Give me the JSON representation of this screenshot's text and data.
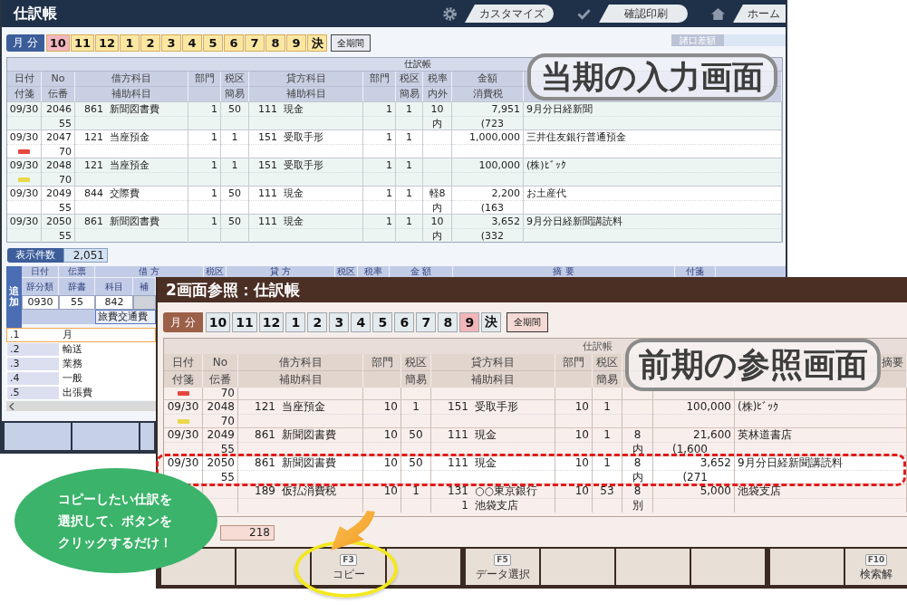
{
  "current_window": {
    "title": "仕訳帳",
    "toolbar": [
      {
        "kind": "gear",
        "label": "カスタマイズ"
      },
      {
        "kind": "check",
        "label": "確認印刷"
      },
      {
        "kind": "home",
        "label": "ホーム"
      }
    ],
    "period_bar": {
      "label": "月 分",
      "months": [
        {
          "label": "10",
          "selected": true
        },
        {
          "label": "11",
          "selected": false
        },
        {
          "label": "12",
          "selected": false
        },
        {
          "label": "1",
          "selected": false
        },
        {
          "label": "2",
          "selected": false
        },
        {
          "label": "3",
          "selected": false
        },
        {
          "label": "4",
          "selected": false
        },
        {
          "label": "5",
          "selected": false
        },
        {
          "label": "6",
          "selected": false
        },
        {
          "label": "7",
          "selected": false
        },
        {
          "label": "8",
          "selected": false
        },
        {
          "label": "9",
          "selected": false
        },
        {
          "label": "決",
          "selected": false
        }
      ],
      "all_label": "全期間"
    },
    "balance": {
      "label": "諸口差額"
    },
    "overlay_label": "当期の入力画面",
    "journal": {
      "title": "仕訳帳",
      "columns": [
        {
          "top": "日付",
          "bottom": "付箋"
        },
        {
          "top": "No",
          "bottom": "伝番"
        },
        {
          "top": "借方科目",
          "bottom": "補助科目"
        },
        {
          "top": "部門"
        },
        {
          "top": "税区",
          "bottom": "簡易"
        },
        {
          "top": "貸方科目",
          "bottom": "補助科目"
        },
        {
          "top": "部門"
        },
        {
          "top": "税区",
          "bottom": "簡易"
        },
        {
          "top": "税率",
          "bottom": "内外"
        },
        {
          "top": "金額",
          "bottom": "消費税"
        },
        {}
      ],
      "rows": [
        {
          "date": "09/30",
          "no": "2046",
          "slip": "55",
          "debit": {
            "code": "861",
            "name": "新聞図書費"
          },
          "debit_dept": "1",
          "tax": "50",
          "credit": {
            "code": "111",
            "name": "現金"
          },
          "credit_dept": "1",
          "credit_tax": "1",
          "rate": "10",
          "inout": "内",
          "amount": "7,951",
          "tax_amount": "(723",
          "memo": "9月分日経新聞"
        },
        {
          "date": "09/30",
          "note": {
            "color": "#e5463f"
          },
          "no": "2047",
          "slip": "70",
          "debit": {
            "code": "121",
            "name": "当座預金"
          },
          "debit_dept": "1",
          "tax": "1",
          "credit": {
            "code": "151",
            "name": "受取手形"
          },
          "credit_dept": "1",
          "credit_tax": "1",
          "amount": "1,000,000",
          "memo": "三井住友銀行普通預金"
        },
        {
          "date": "09/30",
          "note": {
            "color": "#e9d84a"
          },
          "no": "2048",
          "slip": "70",
          "debit": {
            "code": "121",
            "name": "当座預金"
          },
          "debit_dept": "1",
          "tax": "1",
          "credit": {
            "code": "151",
            "name": "受取手形"
          },
          "credit_dept": "1",
          "credit_tax": "1",
          "amount": "100,000",
          "memo": "(株)ﾋﾞｯｸ"
        },
        {
          "date": "09/30",
          "no": "2049",
          "slip": "55",
          "debit": {
            "code": "844",
            "name": "交際費"
          },
          "debit_dept": "1",
          "tax": "50",
          "credit": {
            "code": "111",
            "name": "現金"
          },
          "credit_dept": "1",
          "credit_tax": "1",
          "rate": "軽8",
          "inout": "内",
          "amount": "2,200",
          "tax_amount": "(163",
          "memo": "お土産代"
        },
        {
          "date": "09/30",
          "no": "2050",
          "slip": "55",
          "debit": {
            "code": "861",
            "name": "新聞図書費"
          },
          "debit_dept": "1",
          "tax": "50",
          "credit": {
            "code": "111",
            "name": "現金"
          },
          "credit_dept": "1",
          "credit_tax": "1",
          "rate": "10",
          "inout": "内",
          "amount": "3,652",
          "tax_amount": "(332",
          "memo": "9月分日経新聞講読料"
        }
      ]
    },
    "count": {
      "label": "表示件数",
      "value": "2,051"
    },
    "entry": {
      "label": "追加",
      "header": [
        "日付",
        "伝票",
        "借 方",
        "税区",
        "貸 方",
        "税区",
        "税率",
        "金 額",
        "摘 要",
        "付箋"
      ],
      "subheader": [
        "辞分類",
        "辞書",
        "科目",
        "補"
      ],
      "fields": [
        {
          "value": "0930",
          "disabled": false
        },
        {
          "value": "55",
          "disabled": false
        },
        {
          "value": "842",
          "disabled": false
        },
        {
          "disabled": true
        }
      ],
      "subaccount": "旅費交通費"
    },
    "suggestions": [
      {
        "code": ".1",
        "name": "月",
        "selected": true
      },
      {
        "code": ".2",
        "name": "輸送",
        "selected": false
      },
      {
        "code": ".3",
        "name": "業務",
        "selected": false
      },
      {
        "code": ".4",
        "name": "一般",
        "selected": false
      },
      {
        "code": ".5",
        "name": "出張費",
        "selected": false
      }
    ]
  },
  "reference_window": {
    "title": "2画面参照：仕訳帳",
    "period_bar": {
      "label": "月 分",
      "months": [
        {
          "label": "10",
          "selected": false
        },
        {
          "label": "11",
          "selected": false
        },
        {
          "label": "12",
          "selected": false
        },
        {
          "label": "1",
          "selected": false
        },
        {
          "label": "2",
          "selected": false
        },
        {
          "label": "3",
          "selected": false
        },
        {
          "label": "4",
          "selected": false
        },
        {
          "label": "5",
          "selected": false
        },
        {
          "label": "6",
          "selected": false
        },
        {
          "label": "7",
          "selected": false
        },
        {
          "label": "8",
          "selected": false
        },
        {
          "label": "9",
          "selected": true
        },
        {
          "label": "決",
          "selected": false
        }
      ],
      "all_label": "全期間"
    },
    "overlay_label": "前期の参照画面",
    "journal": {
      "title": "仕訳帳",
      "columns": [
        {
          "top": "日付",
          "bottom": "付箋"
        },
        {
          "top": "No",
          "bottom": "伝番"
        },
        {
          "top": "借方科目",
          "bottom": "補助科目"
        },
        {
          "top": "部門"
        },
        {
          "top": "税区",
          "bottom": "簡易"
        },
        {
          "top": "貸方科目",
          "bottom": "補助科目"
        },
        {
          "top": "部門"
        },
        {
          "top": "税区",
          "bottom": "簡易"
        },
        {},
        {},
        {
          "top": "摘要"
        }
      ],
      "rows": [
        {
          "kind": "partial",
          "selected": false,
          "highlighted": false,
          "note": {
            "color": "#e5463f"
          },
          "slip": "70"
        },
        {
          "kind": "entry",
          "selected": false,
          "highlighted": false,
          "date": "09/30",
          "note": {
            "color": "#e9d84a"
          },
          "no": "2048",
          "slip": "70",
          "debit": {
            "code": "121",
            "name": "当座預金"
          },
          "debit_dept": "10",
          "tax": "1",
          "credit": {
            "code": "151",
            "name": "受取手形"
          },
          "credit_dept": "10",
          "credit_tax": "1",
          "amount": "100,000",
          "memo": "(株)ﾋﾞｯｸ"
        },
        {
          "kind": "entry",
          "selected": false,
          "highlighted": false,
          "date": "09/30",
          "no": "2049",
          "slip": "55",
          "debit": {
            "code": "861",
            "name": "新聞図書費"
          },
          "debit_dept": "10",
          "tax": "50",
          "credit": {
            "code": "111",
            "name": "現金"
          },
          "credit_dept": "10",
          "credit_tax": "1",
          "rate": "8",
          "inout": "内",
          "amount": "21,600",
          "tax_amount": "(1,600",
          "memo": "英林道書店"
        },
        {
          "kind": "entry",
          "selected": true,
          "highlighted": true,
          "date": "09/30",
          "no": "2050",
          "slip": "55",
          "debit": {
            "code": "861",
            "name": "新聞図書費"
          },
          "debit_dept": "10",
          "tax": "50",
          "credit": {
            "code": "111",
            "name": "現金"
          },
          "credit_dept": "10",
          "credit_tax": "1",
          "rate": "8",
          "inout": "内",
          "amount": "3,652",
          "tax_amount": "(271",
          "memo": "9月分日経新聞講読料"
        },
        {
          "kind": "entry",
          "selected": false,
          "highlighted": false,
          "debit": {
            "code": "189",
            "name": "仮払消費税"
          },
          "debit_dept": "10",
          "tax": "1",
          "credit": {
            "code": "131",
            "name": "○○東京銀行"
          },
          "credit_sub": {
            "code": "1",
            "name": "池袋支店"
          },
          "credit_dept": "10",
          "credit_tax": "53",
          "rate": "8",
          "inout": "別",
          "amount": "5,000",
          "memo": "池袋支店"
        }
      ]
    },
    "count": {
      "value": "218"
    },
    "function_keys": [
      {
        "kind": "blank",
        "circled": false
      },
      {
        "kind": "blank",
        "circled": false
      },
      {
        "kind": "labeled",
        "key": "F3",
        "label": "コピー",
        "circled": true
      },
      {
        "kind": "blank",
        "circled": false
      },
      {
        "kind": "labeled",
        "key": "F5",
        "label": "データ選択",
        "circled": false
      },
      {
        "kind": "blank",
        "circled": false
      },
      {
        "kind": "blank",
        "circled": false
      },
      {
        "kind": "blank",
        "circled": false
      },
      {
        "kind": "blank",
        "circled": false
      },
      {
        "kind": "labeled",
        "key": "F10",
        "label": "検索解",
        "circled": false
      }
    ]
  },
  "bubble": {
    "text": "コピーしたい仕訳を選択して、ボタンをクリックするだけ！"
  }
}
